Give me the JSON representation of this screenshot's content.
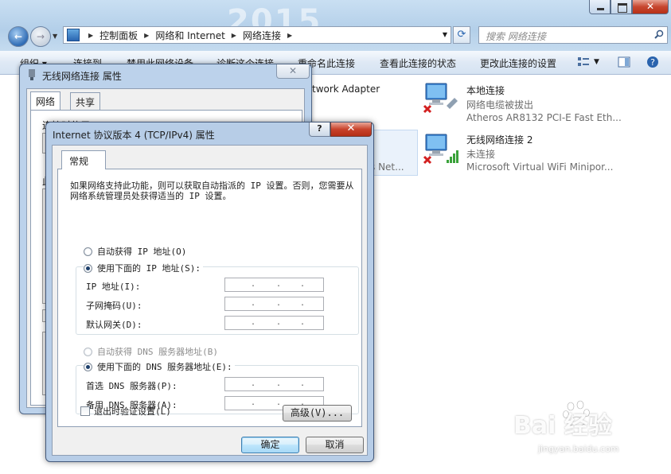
{
  "explorer": {
    "background_deco": "2015",
    "breadcrumb": [
      "控制面板",
      "网络和 Internet",
      "网络连接"
    ],
    "search_placeholder": "搜索 网络连接",
    "toolbar": [
      "组织 ▾",
      "连接到",
      "禁用此网络设备",
      "诊断这个连接",
      "重命名此连接",
      "查看此连接的状态",
      "更改此连接的设置"
    ],
    "adapters": [
      {
        "name": "本地连接",
        "status": "网络电缆被拔出",
        "device": "Atheros AR8132 PCI-E Fast Eth..."
      },
      {
        "name": "无线网络连接 2",
        "status": "未连接",
        "device": "Microsoft Virtual WiFi Minipor..."
      }
    ],
    "partial_adapter_text": "twork Adapter",
    "partial_net_text": "s Net..."
  },
  "wireless_props": {
    "title": "无线网络连接 属性",
    "tabs": [
      "网络",
      "共享"
    ],
    "frag_connect": "连接时使用:",
    "frag_this": "此"
  },
  "ipv4": {
    "title": "Internet 协议版本 4 (TCP/IPv4) 属性",
    "help": "?",
    "tab": "常规",
    "description": "如果网络支持此功能，则可以获取自动指派的 IP 设置。否则，您需要从网络系统管理员处获得适当的 IP 设置。",
    "auto_ip": "自动获得 IP 地址(O)",
    "manual_ip": "使用下面的 IP 地址(S):",
    "ip_label": "IP 地址(I):",
    "mask_label": "子网掩码(U):",
    "gateway_label": "默认网关(D):",
    "auto_dns": "自动获得 DNS 服务器地址(B)",
    "manual_dns": "使用下面的 DNS 服务器地址(E):",
    "pref_dns_label": "首选 DNS 服务器(P):",
    "alt_dns_label": "备用 DNS 服务器(A):",
    "ip_dot": ".",
    "validate": "退出时验证设置(L)",
    "advanced": "高级(V)...",
    "ok": "确定",
    "cancel": "取消"
  },
  "watermark": {
    "brand": "Bai  经验",
    "url": "jingyan.baidu.com"
  }
}
